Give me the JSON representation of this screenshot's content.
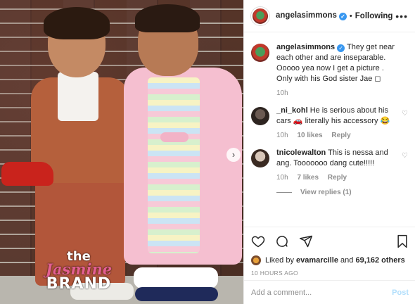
{
  "post": {
    "header": {
      "username": "angelasimmons",
      "following_label": "Following"
    },
    "caption": {
      "username": "angelasimmons",
      "text": "They get near each other and are inseparable. Ooooo yea now I get a picture . Only with his God sister Jae ◻",
      "time": "10h"
    },
    "comments": [
      {
        "username": "_ni_kohl",
        "text": "He is serious about his cars 🚗 literally his accessory 😂",
        "time": "10h",
        "likes": "10 likes",
        "reply": "Reply"
      },
      {
        "username": "tnicolewalton",
        "text": "This is nessa and ang. Tooooooo dang cute!!!!!",
        "time": "10h",
        "likes": "7 likes",
        "reply": "Reply"
      }
    ],
    "view_replies": "View replies (1)",
    "likes": {
      "prefix": "Liked by",
      "user": "evamarcille",
      "joiner": "and",
      "count": "69,162 others"
    },
    "timestamp": "10 HOURS AGO",
    "add_comment_placeholder": "Add a comment...",
    "post_button": "Post"
  },
  "watermark": {
    "the": "the",
    "jasmine": "Jasmine",
    "brand": "BRAND"
  },
  "icons": {
    "verified": "verified-badge-icon",
    "more": "more-options-icon",
    "heart": "heart-icon",
    "comment": "comment-icon",
    "share": "share-icon",
    "bookmark": "bookmark-icon",
    "carousel": "carousel-next-icon"
  },
  "colors": {
    "verified_blue": "#3897f0",
    "post_button": "#b2dffc",
    "meta_gray": "#8e8e8e",
    "watermark_pink": "#e45f92"
  }
}
